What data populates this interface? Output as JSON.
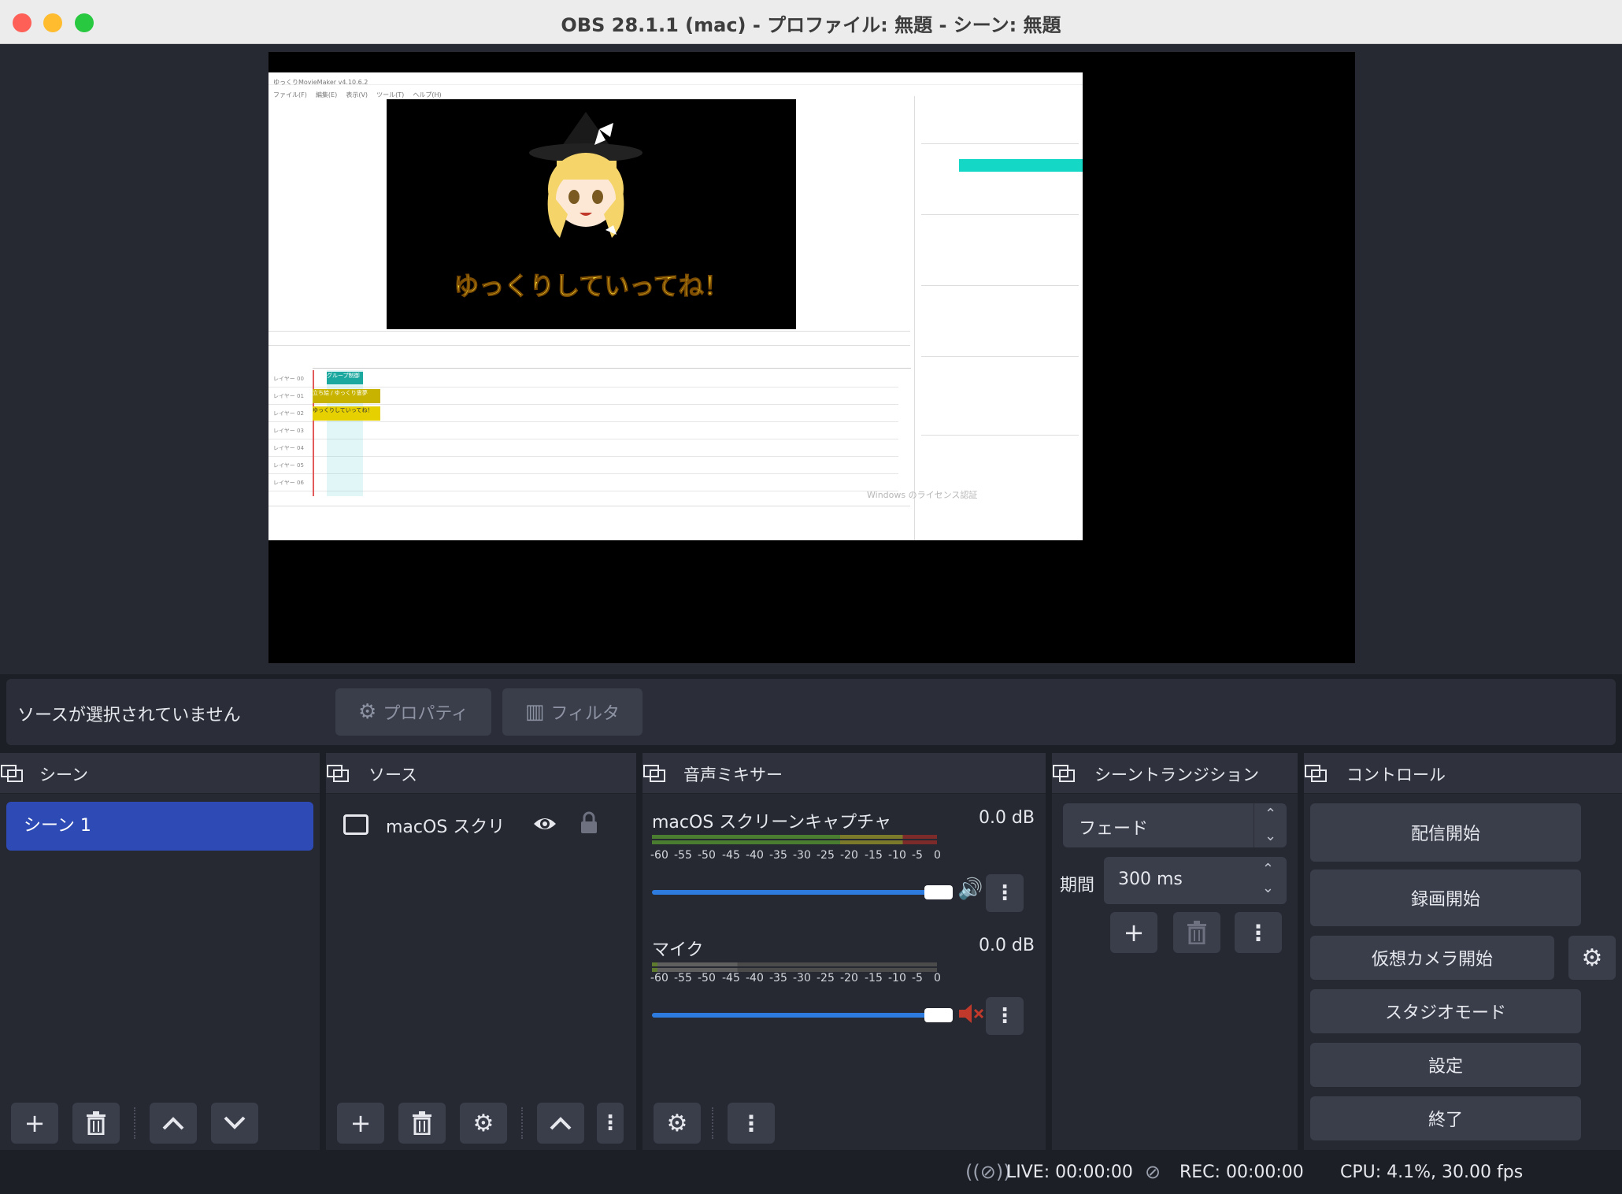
{
  "window": {
    "title": "OBS 28.1.1 (mac) - プロファイル: 無題 - シーン: 無題"
  },
  "capture": {
    "app_title": "ゆっくりMovieMaker v4.10.6.2",
    "menu": [
      "ファイル(F)",
      "編集(E)",
      "表示(V)",
      "ツール(T)",
      "ヘルプ(H)"
    ],
    "subtitle": "ゆっくりしていってね！",
    "tracks": [
      "レイヤー 00",
      "レイヤー 01",
      "レイヤー 02",
      "レイヤー 03",
      "レイヤー 04",
      "レイヤー 05",
      "レイヤー 06"
    ],
    "clips": [
      "グループ制御",
      "立ち絵 / ゆっくり霊夢",
      "ゆっくりしていってね！"
    ],
    "watermark": "Windows のライセンス認証"
  },
  "source_bar": {
    "no_source": "ソースが選択されていません",
    "properties": "プロパティ",
    "filters": "フィルタ"
  },
  "docks": {
    "scenes": {
      "title": "シーン",
      "items": [
        "シーン 1"
      ]
    },
    "sources": {
      "title": "ソース",
      "items": [
        {
          "name": "macOS スクリ"
        }
      ]
    },
    "mixer": {
      "title": "音声ミキサー",
      "ticks": [
        "-60",
        "-55",
        "-50",
        "-45",
        "-40",
        "-35",
        "-30",
        "-25",
        "-20",
        "-15",
        "-10",
        "-5",
        "0"
      ],
      "channels": [
        {
          "name": "macOS スクリーンキャプチャ",
          "db": "0.0 dB",
          "volume": 1.0,
          "muted": false
        },
        {
          "name": "マイク",
          "db": "0.0 dB",
          "volume": 1.0,
          "muted": true
        }
      ]
    },
    "transitions": {
      "title": "シーントランジション",
      "type": "フェード",
      "duration_label": "期間",
      "duration": "300 ms"
    },
    "controls": {
      "title": "コントロール",
      "start_streaming": "配信開始",
      "start_recording": "録画開始",
      "start_virtual_cam": "仮想カメラ開始",
      "studio_mode": "スタジオモード",
      "settings": "設定",
      "exit": "終了"
    }
  },
  "status": {
    "live": "LIVE: 00:00:00",
    "rec": "REC: 00:00:00",
    "cpu": "CPU: 4.1%, 30.00 fps"
  },
  "colors": {
    "accent": "#2e4ab5",
    "fader": "#2e7be0",
    "bg": "#262932"
  }
}
